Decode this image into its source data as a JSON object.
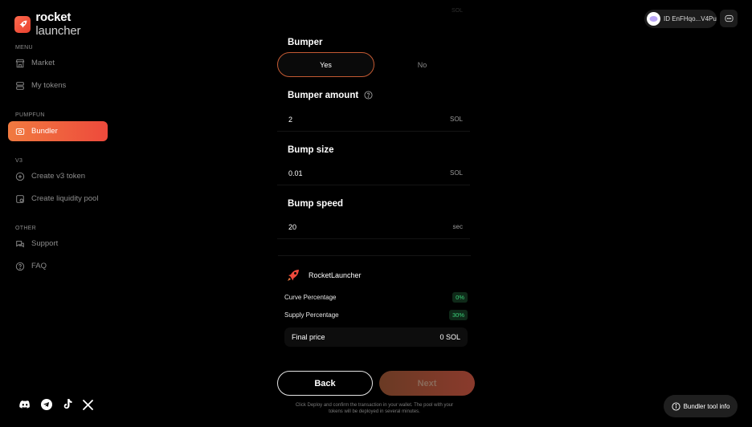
{
  "brand": {
    "name_bold": "rocket",
    "name_light": "launcher"
  },
  "sidebar": {
    "sections": [
      "MENU",
      "PUMPFUN",
      "V3",
      "OTHER"
    ],
    "items": [
      {
        "label": "Market",
        "icon": "store-icon"
      },
      {
        "label": "My tokens",
        "icon": "stack-icon"
      },
      {
        "label": "Bundler",
        "icon": "bundler-icon",
        "active": true
      },
      {
        "label": "Create v3 token",
        "icon": "plus-circle-icon"
      },
      {
        "label": "Create liquidity pool",
        "icon": "pool-icon"
      },
      {
        "label": "Support",
        "icon": "chat-icon"
      },
      {
        "label": "FAQ",
        "icon": "question-icon"
      }
    ],
    "socials": [
      "discord-icon",
      "telegram-icon",
      "tiktok-icon",
      "x-icon"
    ]
  },
  "header": {
    "wallet_label": "ID EnFHqo...V4Pu"
  },
  "form": {
    "top_unit": "SOL",
    "bumper": {
      "title": "Bumper",
      "yes": "Yes",
      "no": "No",
      "selected": "Yes"
    },
    "bumper_amount": {
      "title": "Bumper amount",
      "value": "2",
      "unit": "SOL"
    },
    "bump_size": {
      "title": "Bump size",
      "value": "0.01",
      "unit": "SOL"
    },
    "bump_speed": {
      "title": "Bump speed",
      "value": "20",
      "unit": "sec"
    }
  },
  "summary": {
    "name": "RocketLauncher",
    "curve_label": "Curve Percentage",
    "curve_value": "0%",
    "supply_label": "Supply Percentage",
    "supply_value": "30%",
    "final_label": "Final price",
    "final_value": "0 SOL"
  },
  "actions": {
    "back": "Back",
    "next": "Next",
    "hint": "Click Deploy and confirm the transaction in your wallet. The pool with your tokens will be deployed in several minutes."
  },
  "info_button": "Bundler tool info",
  "colors": {
    "accent_start": "#f07a40",
    "accent_end": "#ee4a3c",
    "success": "#3bd27a"
  }
}
